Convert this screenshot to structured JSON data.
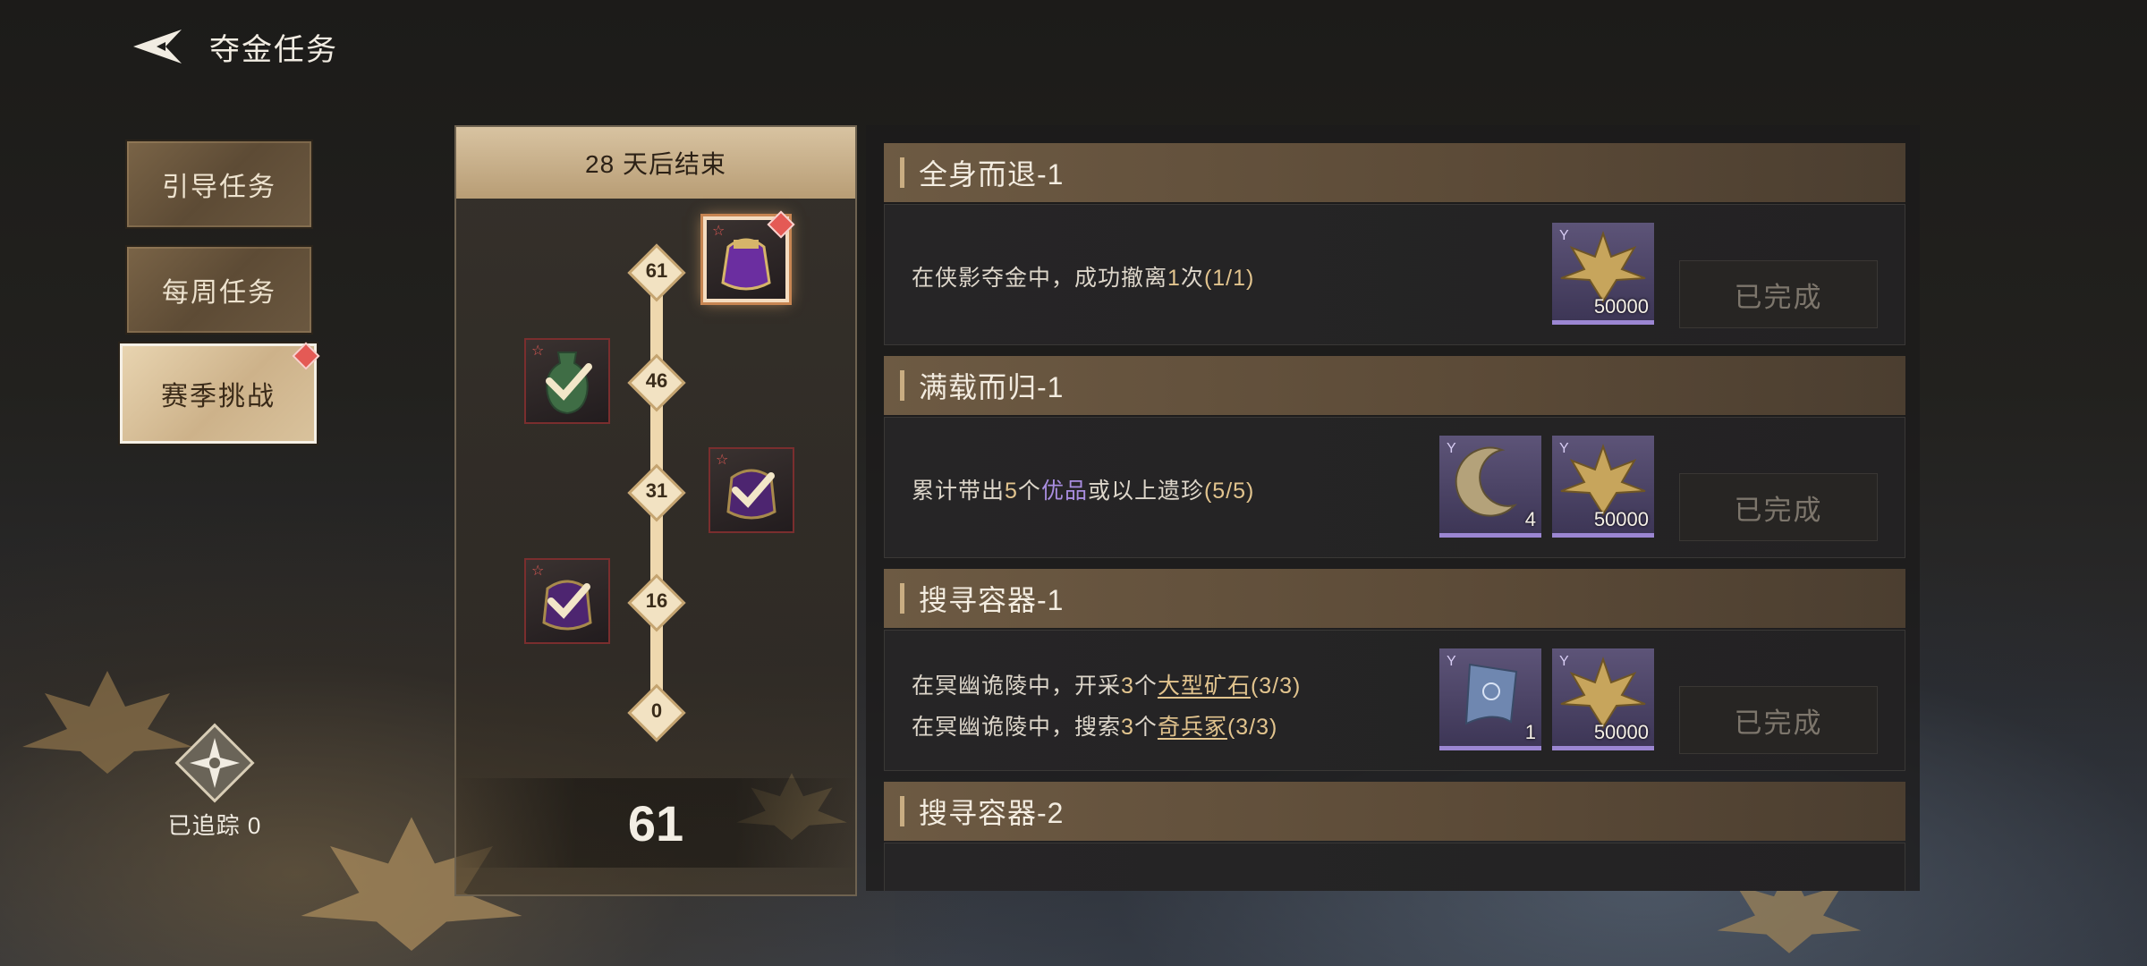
{
  "header": {
    "title": "夺金任务",
    "back_icon": "back-arrow-icon"
  },
  "tabs": [
    {
      "label": "引导任务",
      "active": false
    },
    {
      "label": "每周任务",
      "active": false
    },
    {
      "label": "赛季挑战",
      "active": true,
      "badge": true
    }
  ],
  "tracker": {
    "label": "已追踪 0",
    "icon": "compass-star-icon"
  },
  "progress": {
    "header": "28 天后结束",
    "score": "61",
    "milestones": [
      "61",
      "46",
      "31",
      "16",
      "0"
    ],
    "rewards": [
      {
        "milestone": "61",
        "claimed": false,
        "icon": "purple-pouch-icon"
      },
      {
        "milestone": "46",
        "claimed": true,
        "icon": "green-vase-icon"
      },
      {
        "milestone": "31",
        "claimed": true,
        "icon": "purple-pouch-icon"
      },
      {
        "milestone": "16",
        "claimed": true,
        "icon": "purple-pouch-icon"
      }
    ]
  },
  "tasks": [
    {
      "title": "全身而退-1",
      "lines": [
        {
          "a": "在侠影夺金中，成功撤离",
          "b": "1",
          "c": "次",
          "d": "(1/1)"
        }
      ],
      "rewards": [
        {
          "icon": "gold-leaf-icon",
          "qty": "50000"
        }
      ],
      "status": "已完成"
    },
    {
      "title": "满载而归-1",
      "lines": [
        {
          "a": "累计带出",
          "b": "5",
          "c": "个",
          "e": "优品",
          "f": "或以上遗珍",
          "d": "(5/5)"
        }
      ],
      "rewards": [
        {
          "icon": "crescent-moon-icon",
          "qty": "4"
        },
        {
          "icon": "gold-leaf-icon",
          "qty": "50000"
        }
      ],
      "status": "已完成"
    },
    {
      "title": "搜寻容器-1",
      "lines": [
        {
          "a": "在冥幽诡陵中，开采",
          "b": "3",
          "c": "个",
          "link": "大型矿石",
          "d": "(3/3)"
        },
        {
          "a": "在冥幽诡陵中，搜索",
          "b": "3",
          "c": "个",
          "link": "奇兵冢",
          "d": "(3/3)"
        }
      ],
      "rewards": [
        {
          "icon": "blue-scroll-icon",
          "qty": "1"
        },
        {
          "icon": "gold-leaf-icon",
          "qty": "50000"
        }
      ],
      "status": "已完成"
    },
    {
      "title": "搜寻容器-2"
    }
  ],
  "colors": {
    "accent_gold": "#e2c48e",
    "rare_purple": "#a98de0",
    "badge_red": "#e45a55"
  }
}
